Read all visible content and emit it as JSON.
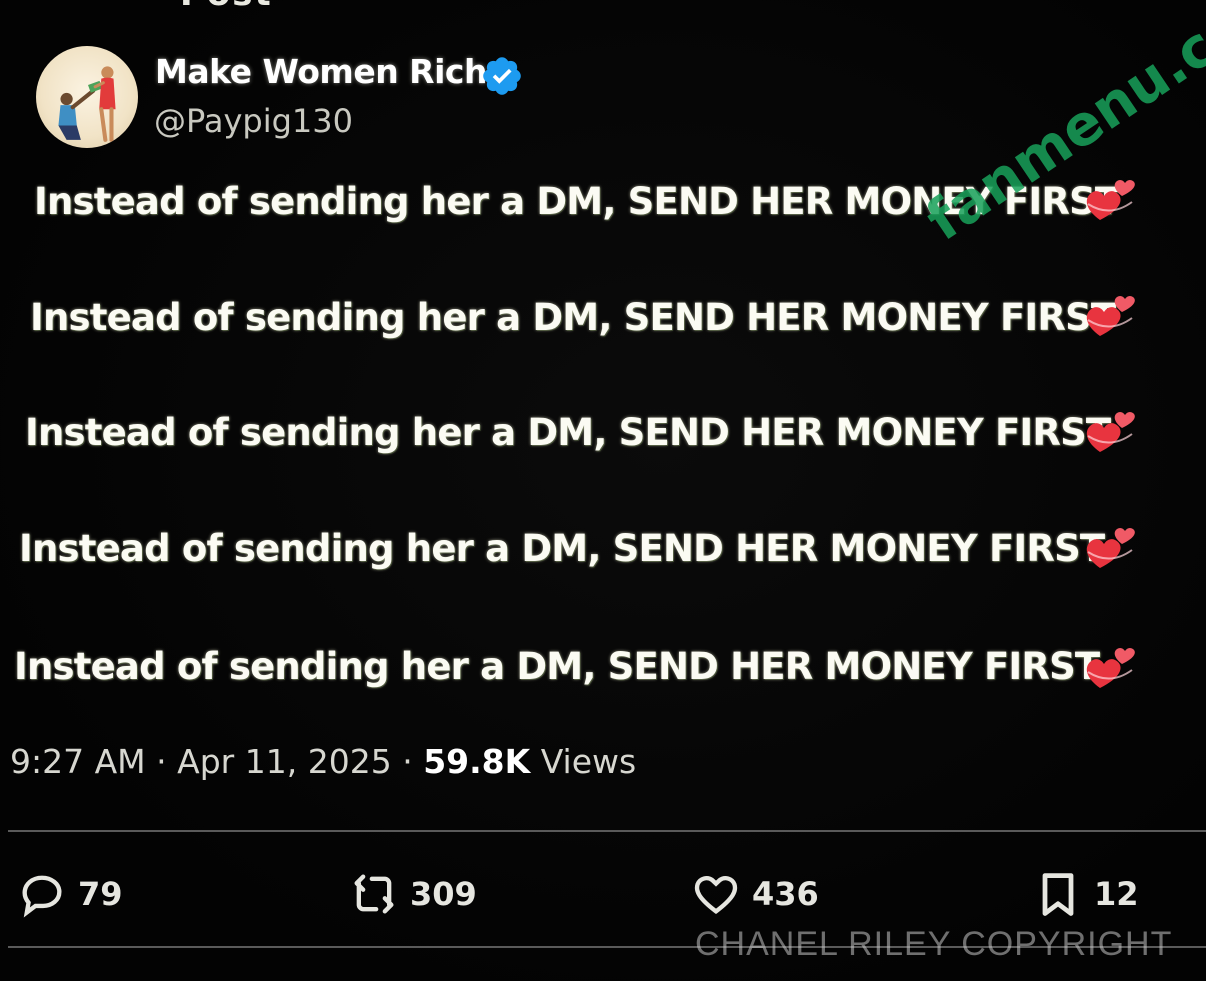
{
  "header_fragment": "Post",
  "author": {
    "display_name": "Make Women Rich",
    "handle": "@Paypig130",
    "verified": true
  },
  "tweet_lines": [
    {
      "text": "Instead of sending her a DM, SEND HER MONEY FIRST",
      "emoji": "revolving-hearts-icon"
    },
    {
      "text": "Instead of sending her a DM, SEND HER MONEY FIRST",
      "emoji": "revolving-hearts-icon"
    },
    {
      "text": "Instead of sending her a DM, SEND HER MONEY FIRST",
      "emoji": "revolving-hearts-icon"
    },
    {
      "text": "Instead of sending her a DM, SEND HER MONEY FIRST",
      "emoji": "revolving-hearts-icon"
    },
    {
      "text": "Instead of sending her a DM, SEND HER MONEY FIRST",
      "emoji": "revolving-hearts-icon"
    }
  ],
  "meta": {
    "time": "9:27 AM",
    "separator": "·",
    "date": "Apr 11, 2025",
    "views_count": "59.8K",
    "views_label": "Views"
  },
  "actions": {
    "replies": "79",
    "reposts": "309",
    "likes": "436",
    "bookmarks": "12"
  },
  "watermarks": {
    "site": "fanmenu.com",
    "copyright": "CHANEL RILEY COPYRIGHT"
  },
  "colors": {
    "background": "#050505",
    "verified_blue": "#1d9bf0",
    "watermark_green": "#18a15a",
    "heart_red": "#e8343f"
  }
}
